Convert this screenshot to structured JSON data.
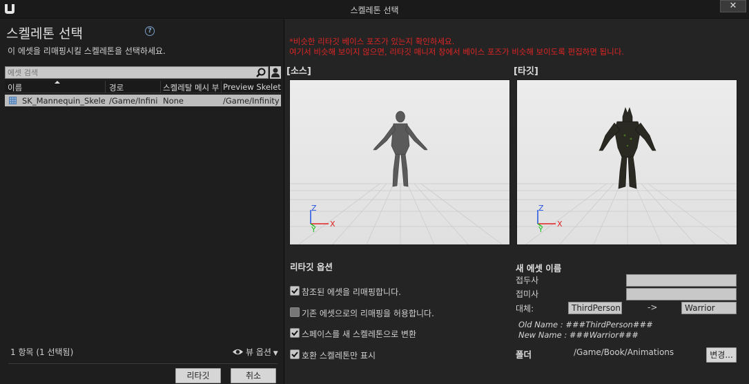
{
  "window": {
    "title": "스켈레톤 선택",
    "close_label": "✕"
  },
  "left": {
    "title": "스켈레톤 선택",
    "description": "이 에셋을 리매핑시킬 스켈레톤을 선택하세요.",
    "search_placeholder": "에셋 검색",
    "columns": [
      "이름",
      "경로",
      "스켈레탈 메시 부",
      "Preview Skeleta"
    ],
    "rows": [
      {
        "name": "SK_Mannequin_Skeleto",
        "path": "/Game/Infini",
        "skeletal_mesh": "None",
        "preview": "/Game/Infinity"
      }
    ],
    "count_text": "1 항목 (1 선택됨)",
    "view_options_label": "뷰 옵션",
    "retarget_button": "리타깃",
    "cancel_button": "취소"
  },
  "right": {
    "warning_line1": "*비슷한 리타깃 베이스 포즈가 있는지 확인하세요.",
    "warning_line2": "여기서 비슷해 보이지 않으면, 리타깃 매니저 창에서 베이스 포즈가 비슷해 보이도록 편집하면 됩니다.",
    "source_label": "[소스]",
    "target_label": "[타깃]",
    "axis_z": "Z",
    "axis_y": "Y",
    "axis_x": "X",
    "retarget_options_title": "리타깃 옵션",
    "options": [
      {
        "label": "참조된 에셋을 리매핑합니다.",
        "checked": true
      },
      {
        "label": "기존 에셋으로의 리매핑을 허용합니다.",
        "checked": false
      },
      {
        "label": "스페이스를 새 스켈레톤으로 변환",
        "checked": true
      },
      {
        "label": "호환 스켈레톤만 표시",
        "checked": true
      }
    ],
    "new_asset_title": "새 에셋 이름",
    "prefix_label": "접두사",
    "prefix_value": "",
    "suffix_label": "접미사",
    "suffix_value": "",
    "replace_label": "대체:",
    "replace_from": "ThirdPerson",
    "replace_arrow": "->",
    "replace_to": "Warrior",
    "old_name": "Old Name : ###ThirdPerson###",
    "new_name": "New Name : ###Warrior###",
    "folder_label": "폴더",
    "folder_value": "/Game/Book/Animations",
    "change_button": "변경..."
  },
  "colors": {
    "warning": "#e02424",
    "axis_x": "#e02020",
    "axis_y": "#20c020",
    "axis_z": "#2050e0"
  }
}
